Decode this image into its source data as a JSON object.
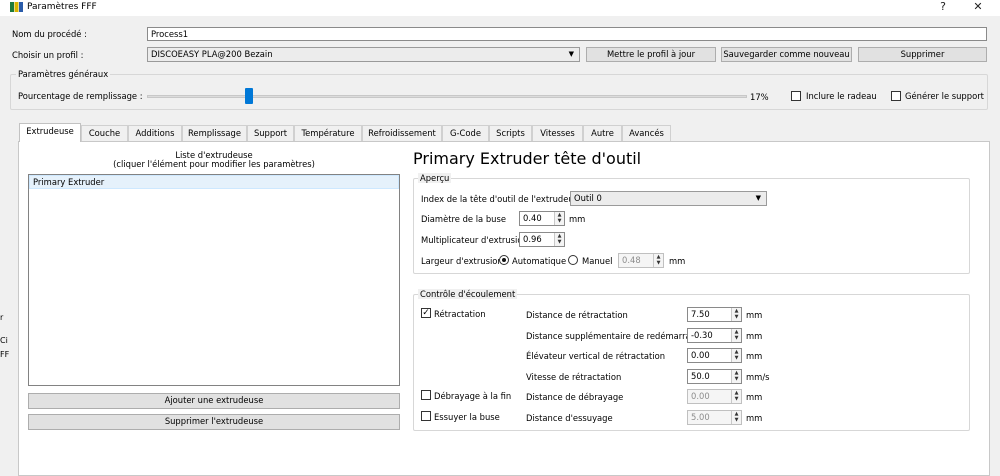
{
  "window": {
    "title": "Paramètres FFF",
    "help": "?",
    "close": "✕"
  },
  "process": {
    "label": "Nom du procédé :",
    "value": "Process1"
  },
  "profile": {
    "label": "Choisir un profil :",
    "selected": "DISCOEASY PLA@200 Bezain",
    "update_btn": "Mettre le profil à jour",
    "save_new_btn": "Sauvegarder comme nouveau",
    "delete_btn": "Supprimer"
  },
  "general": {
    "title": "Paramètres généraux",
    "infill_label": "Pourcentage de remplissage :",
    "infill_value": "17%",
    "infill_fraction": 0.17,
    "raft_label": "Inclure le radeau",
    "raft_checked": false,
    "support_label": "Générer le support",
    "support_checked": false
  },
  "tabs": [
    {
      "label": "Extrudeuse",
      "active": true
    },
    {
      "label": "Couche"
    },
    {
      "label": "Additions"
    },
    {
      "label": "Remplissage"
    },
    {
      "label": "Support"
    },
    {
      "label": "Température"
    },
    {
      "label": "Refroidissement"
    },
    {
      "label": "G-Code"
    },
    {
      "label": "Scripts"
    },
    {
      "label": "Vitesses"
    },
    {
      "label": "Autre"
    },
    {
      "label": "Avancés"
    }
  ],
  "extruder_list": {
    "caption1": "Liste d'extrudeuse",
    "caption2": "(cliquer l'élément pour modifier les paramètres)",
    "items": [
      "Primary Extruder"
    ],
    "add_btn": "Ajouter une extrudeuse",
    "remove_btn": "Supprimer l'extrudeuse"
  },
  "extruder": {
    "heading": "Primary Extruder tête d'outil",
    "overview": {
      "title": "Aperçu",
      "tool_index_label": "Index de la tête d'outil de l'extrudeuse",
      "tool_index_value": "Outil 0",
      "nozzle_label": "Diamètre de la buse",
      "nozzle_value": "0.40",
      "nozzle_unit": "mm",
      "multiplier_label": "Multiplicateur d'extrusion",
      "multiplier_value": "0.96",
      "width_label": "Largeur d'extrusion",
      "width_auto": "Automatique",
      "width_manual": "Manuel",
      "width_value": "0.48",
      "width_unit": "mm"
    },
    "flow": {
      "title": "Contrôle d'écoulement",
      "retraction_label": "Rétractation",
      "retraction_checked": true,
      "coast_label": "Débrayage à la fin",
      "coast_checked": false,
      "wipe_label": "Essuyer la buse",
      "wipe_checked": false,
      "fields": [
        {
          "label": "Distance de rétractation",
          "value": "7.50",
          "unit": "mm",
          "disabled": false
        },
        {
          "label": "Distance supplémentaire de redémarrage",
          "value": "-0.30",
          "unit": "mm",
          "disabled": false
        },
        {
          "label": "Élévateur vertical de rétractation",
          "value": "0.00",
          "unit": "mm",
          "disabled": false
        },
        {
          "label": "Vitesse de rétractation",
          "value": "50.0",
          "unit": "mm/s",
          "disabled": false
        },
        {
          "label": "Distance de débrayage",
          "value": "0.00",
          "unit": "mm",
          "disabled": true
        },
        {
          "label": "Distance d'essuyage",
          "value": "5.00",
          "unit": "mm",
          "disabled": true
        }
      ]
    }
  },
  "edge_fragments": [
    "r",
    "Ci",
    "FF"
  ]
}
